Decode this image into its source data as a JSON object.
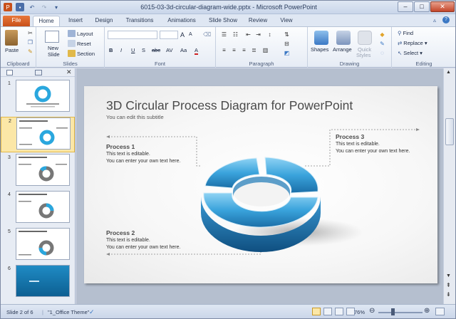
{
  "window": {
    "title": "6015-03-3d-circular-diagram-wide.pptx - Microsoft PowerPoint"
  },
  "tabs": [
    "File",
    "Home",
    "Insert",
    "Design",
    "Transitions",
    "Animations",
    "Slide Show",
    "Review",
    "View"
  ],
  "ribbon": {
    "clipboard": {
      "paste": "Paste",
      "label": "Clipboard"
    },
    "slides": {
      "new_slide": "New",
      "new_slide2": "Slide",
      "layout": "Layout",
      "reset": "Reset",
      "section": "Section",
      "label": "Slides"
    },
    "font": {
      "label": "Font",
      "size_up": "A",
      "size_down": "A",
      "bold": "B",
      "italic": "I",
      "underline": "U",
      "strike": "S",
      "shadow": "abc",
      "spacing": "AV",
      "case": "Aa",
      "color": "A"
    },
    "paragraph": {
      "label": "Paragraph"
    },
    "drawing": {
      "shapes": "Shapes",
      "arrange": "Arrange",
      "quick_styles": "Quick",
      "quick_styles2": "Styles",
      "label": "Drawing"
    },
    "editing": {
      "find": "Find",
      "replace": "Replace",
      "select": "Select",
      "label": "Editing"
    }
  },
  "slides_pane": {
    "numbers": [
      "1",
      "2",
      "3",
      "4",
      "5",
      "6"
    ],
    "selected": 2
  },
  "slide": {
    "title": "3D Circular Process Diagram  for PowerPoint",
    "subtitle": "You can edit this subtitle",
    "process1": {
      "heading": "Process 1",
      "line1": "This text is editable.",
      "line2": "You can enter your own text here."
    },
    "process2": {
      "heading": "Process 2",
      "line1": "This text is editable.",
      "line2": "You can enter your own text here."
    },
    "process3": {
      "heading": "Process 3",
      "line1": "This text is editable.",
      "line2": "You can enter your own text here."
    }
  },
  "status": {
    "slide_info": "Slide 2 of 6",
    "theme": "\"1_Office Theme\"",
    "zoom": "76%"
  },
  "colors": {
    "accent": "#2aa7de",
    "file_tab": "#d0581f",
    "ribbon": "#e6ecf5"
  }
}
